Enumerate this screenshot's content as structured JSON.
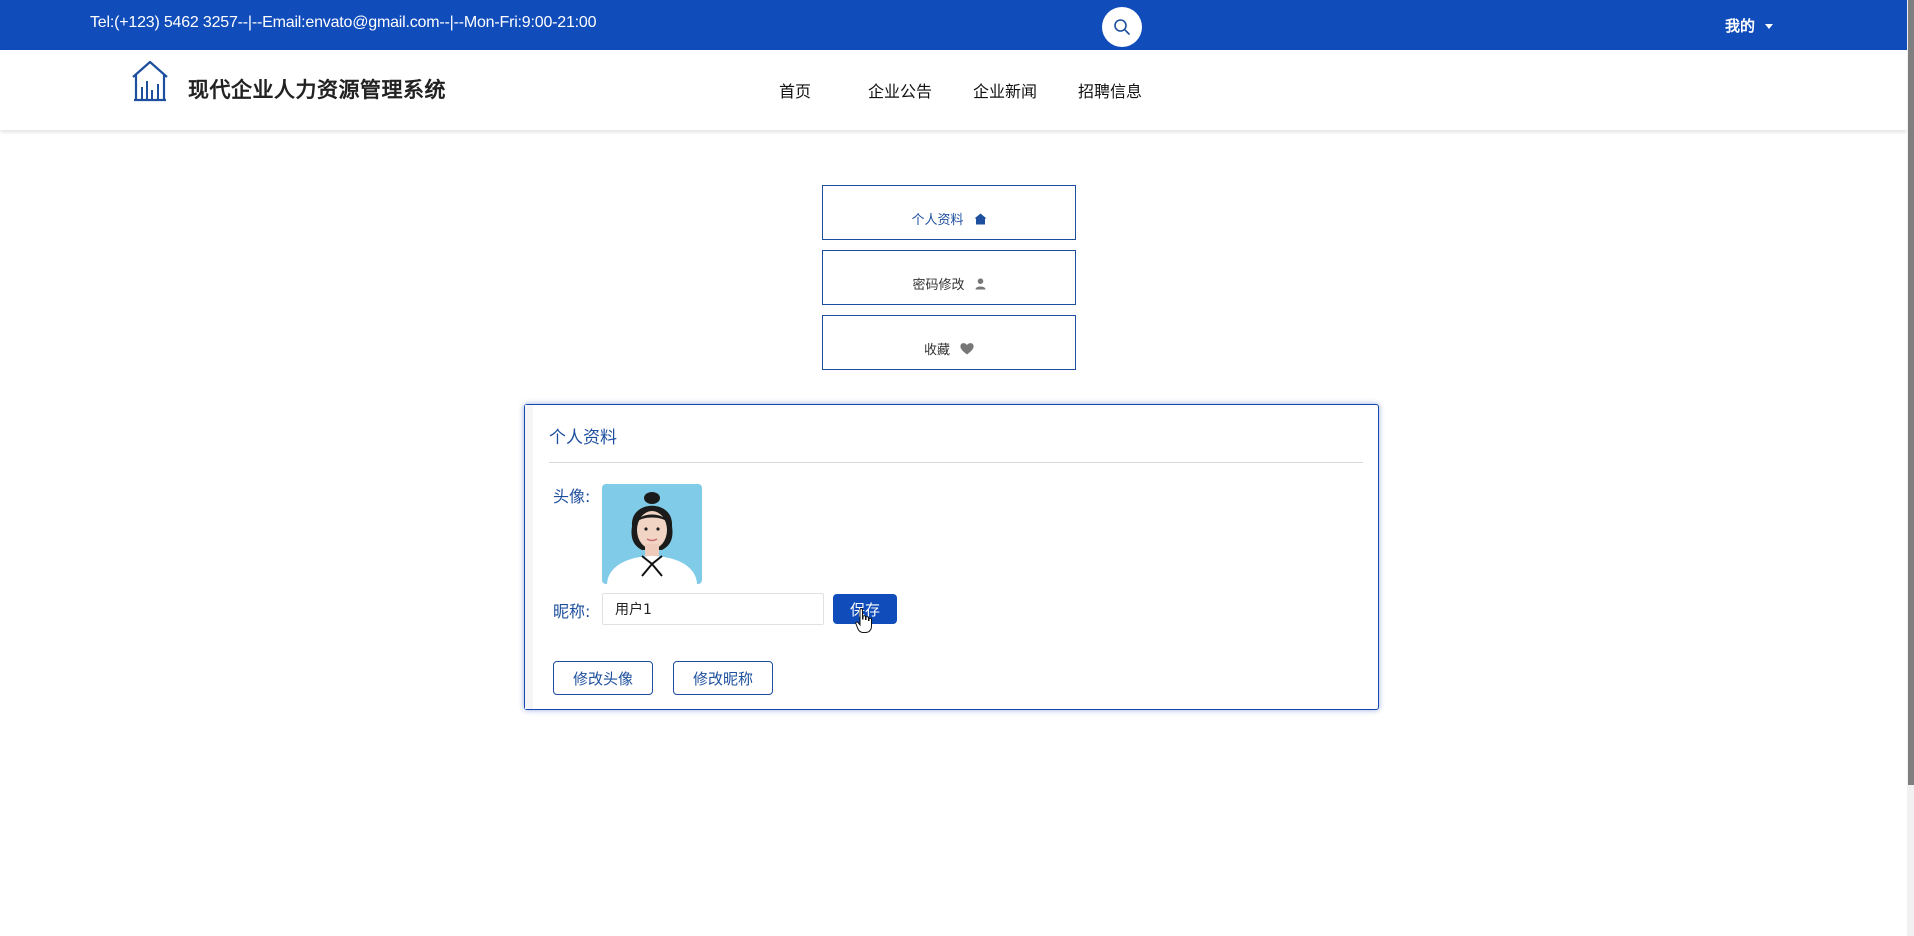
{
  "topbar": {
    "contact": "Tel:(+123) 5462 3257--|--Email:envato@gmail.com--|--Mon-Fri:9:00-21:00",
    "user_menu": "我的"
  },
  "header": {
    "site_title": "现代企业人力资源管理系统",
    "nav": [
      "首页",
      "企业公告",
      "企业新闻",
      "招聘信息"
    ]
  },
  "side_menu": {
    "items": [
      {
        "label": "个人资料",
        "icon": "home-icon"
      },
      {
        "label": "密码修改",
        "icon": "user-icon"
      },
      {
        "label": "收藏",
        "icon": "heart-icon"
      }
    ]
  },
  "profile": {
    "title": "个人资料",
    "avatar_label": "头像:",
    "nickname_label": "昵称:",
    "nickname_value": "用户1",
    "save_label": "保存",
    "change_avatar_label": "修改头像",
    "change_nickname_label": "修改昵称"
  },
  "colors": {
    "primary": "#104cba",
    "accent": "#1d4f9e"
  }
}
